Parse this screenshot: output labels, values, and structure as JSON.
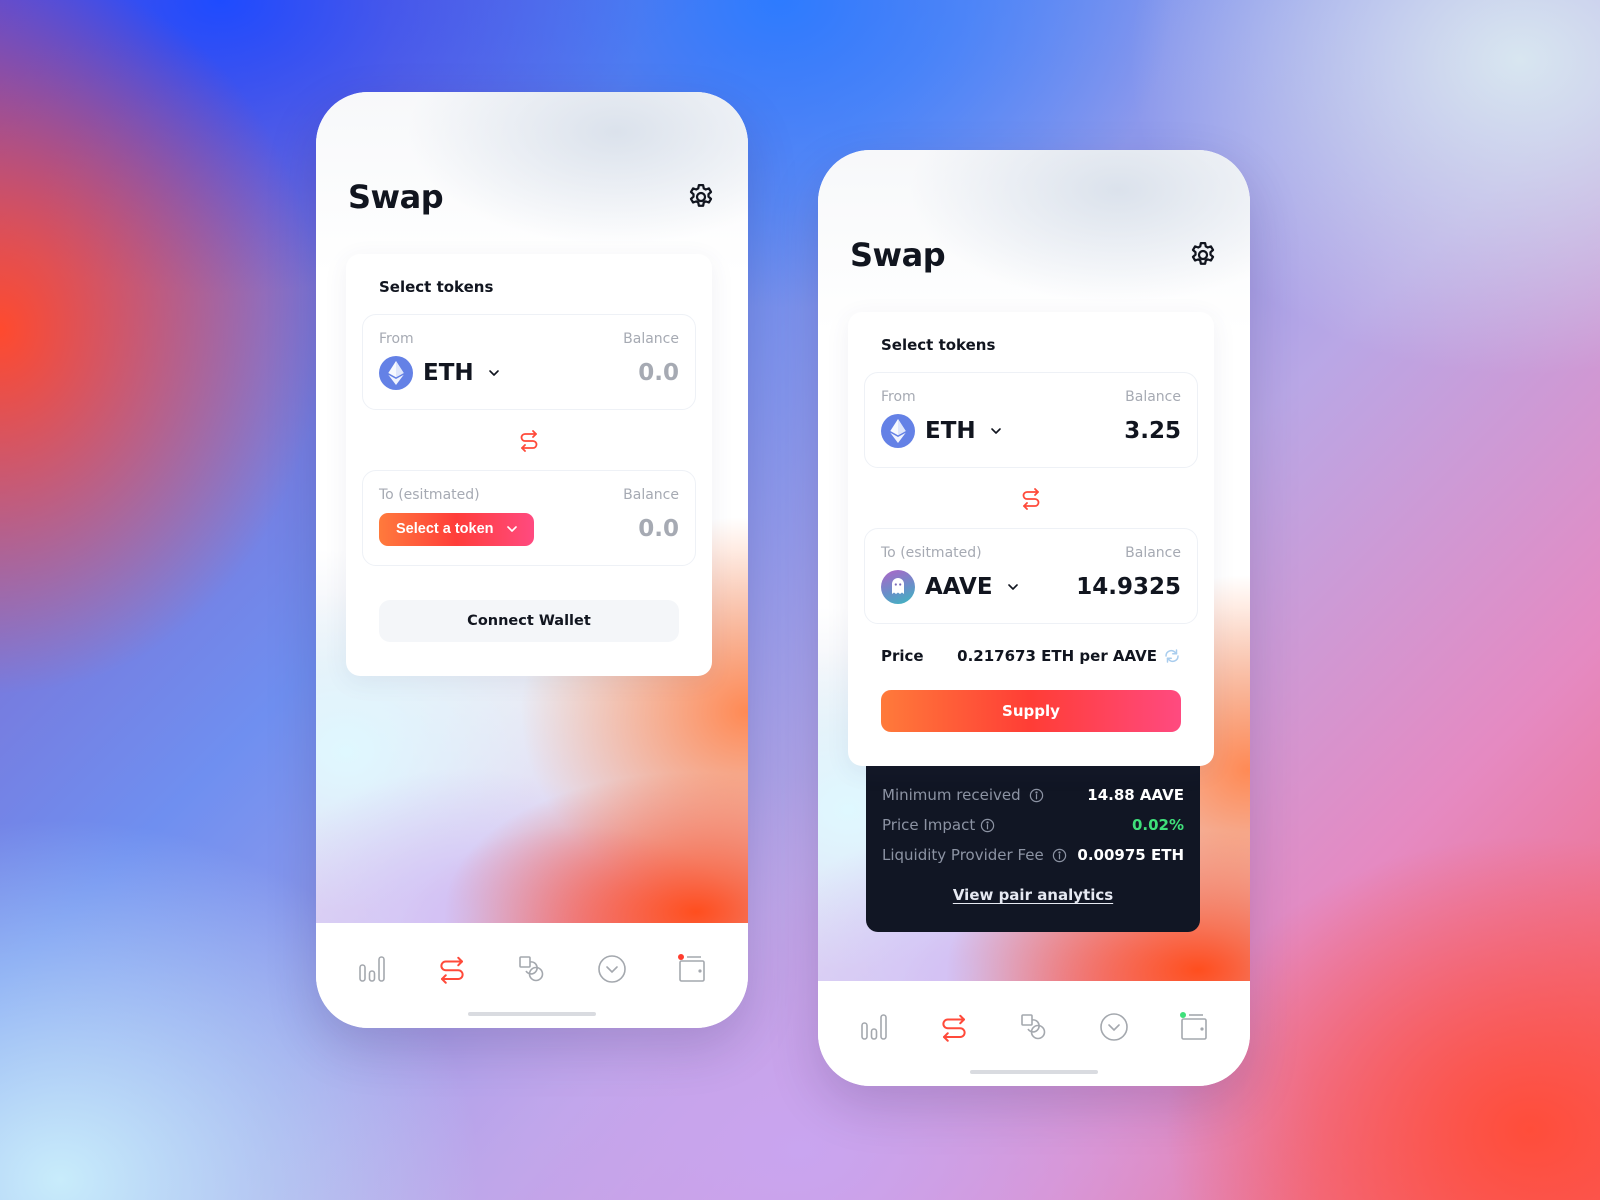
{
  "screens": [
    {
      "title": "Swap",
      "card_title": "Select tokens",
      "from": {
        "label": "From",
        "balance_label": "Balance",
        "token": "ETH",
        "balance": "0.0"
      },
      "to": {
        "label": "To (esitmated)",
        "balance_label": "Balance",
        "select_label": "Select a token",
        "balance": "0.0"
      },
      "connect_wallet_label": "Connect Wallet",
      "wallet_badge_color": "#ff3d2e"
    },
    {
      "title": "Swap",
      "card_title": "Select tokens",
      "from": {
        "label": "From",
        "balance_label": "Balance",
        "token": "ETH",
        "balance": "3.25"
      },
      "to": {
        "label": "To (esitmated)",
        "balance_label": "Balance",
        "token": "AAVE",
        "balance": "14.9325"
      },
      "price": {
        "label": "Price",
        "value": "0.217673 ETH per AAVE"
      },
      "supply_label": "Supply",
      "details": {
        "rows": [
          {
            "label": "Minimum received",
            "value": "14.88 AAVE"
          },
          {
            "label": "Price Impact",
            "value": "0.02%"
          },
          {
            "label": "Liquidity Provider Fee",
            "value": "0.00975 ETH"
          }
        ],
        "link_label": "View pair analytics"
      },
      "wallet_badge_color": "#3fe07a"
    }
  ],
  "tabbar": {
    "items": [
      {
        "name": "analytics",
        "icon": "bar-chart-icon",
        "active": false
      },
      {
        "name": "swap",
        "icon": "swap-icon",
        "active": true
      },
      {
        "name": "pool",
        "icon": "shapes-icon",
        "active": false
      },
      {
        "name": "more",
        "icon": "chevron-circle-icon",
        "active": false
      },
      {
        "name": "wallet",
        "icon": "wallet-icon",
        "active": false
      }
    ]
  },
  "colors": {
    "accent": "#ff3d3a",
    "accent_start": "#ff7a3c",
    "accent_end": "#ff4a80",
    "positive": "#3fe07a",
    "dark_panel": "#111624",
    "icon_gray": "#a4a8ae"
  }
}
